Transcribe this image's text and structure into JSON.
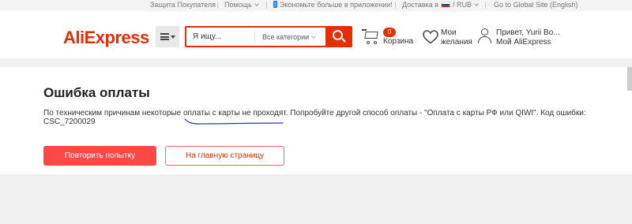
{
  "topbar": {
    "buyer_protection": "Защита Покупателя",
    "help": "Помощь",
    "app_promo": "Экономьте больше в приложении!",
    "delivery": "Доставка в",
    "currency": "/ RUB",
    "global_site": "Go to Global Site (English)"
  },
  "header": {
    "logo": "AliExpress",
    "search_placeholder": "Я ищу...",
    "category": "Все категории",
    "cart_count": "0",
    "cart_label": "Корзина",
    "wishlist_line1": "Мои",
    "wishlist_line2": "желания",
    "greeting": "Привет, Yurii Bo...",
    "account": "Мой AliExpress"
  },
  "content": {
    "title": "Ошибка оплаты",
    "message": "По техническим причинам некоторые оплаты с карты не проходят. Попробуйте другой способ оплаты - \"Оплата с карты РФ или QIWI\". Код ошибки: CSC_7200029",
    "retry_button": "Повторить попытку",
    "home_button": "На главную страницу"
  },
  "colors": {
    "brand": "#e62e04",
    "button": "#fd4848",
    "annotation": "#2a33c8"
  }
}
